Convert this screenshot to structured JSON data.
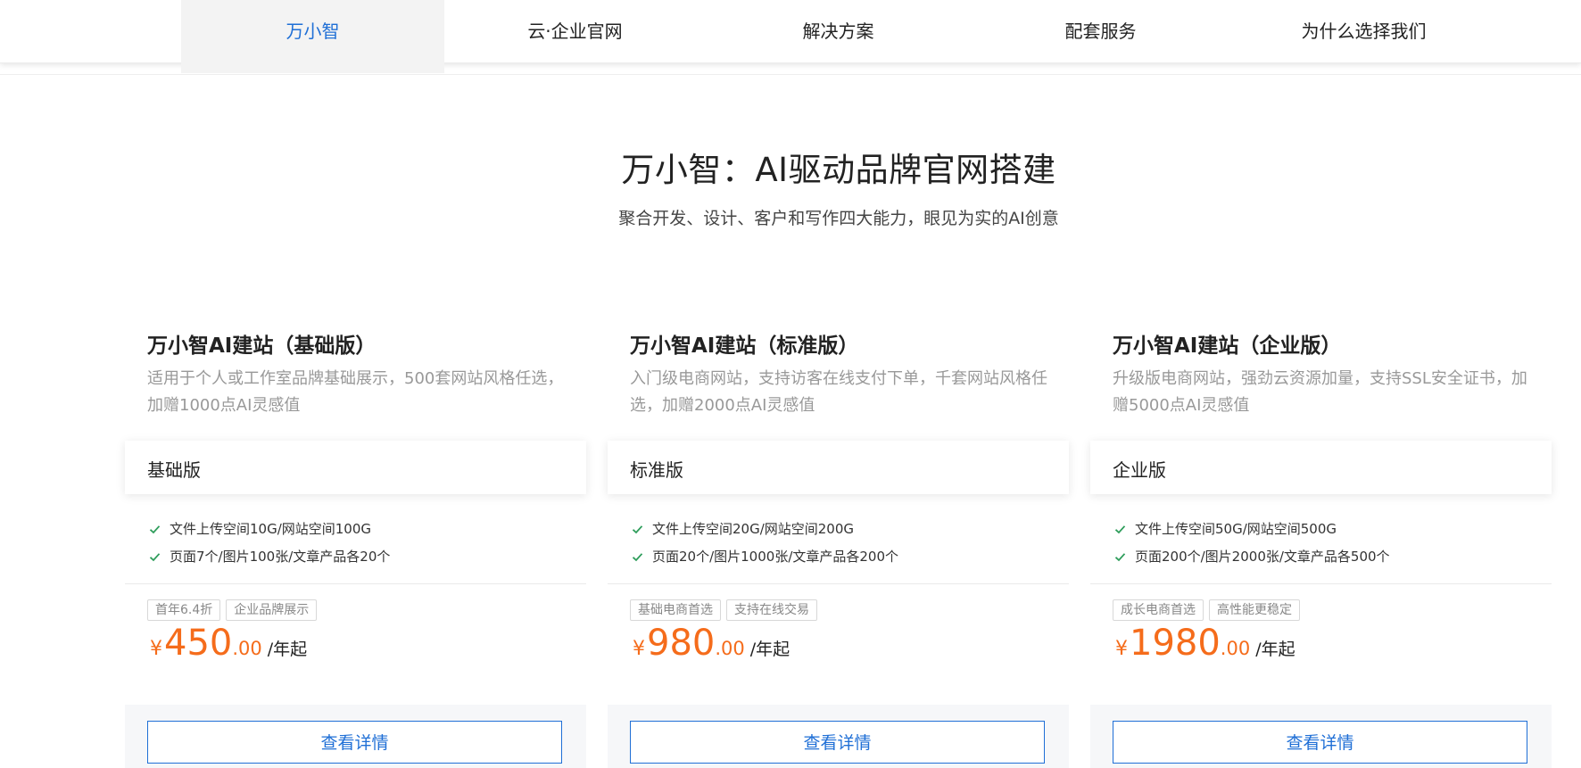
{
  "nav": {
    "tabs": [
      {
        "label": "万小智",
        "active": true
      },
      {
        "label": "云·企业官网",
        "active": false
      },
      {
        "label": "解决方案",
        "active": false
      },
      {
        "label": "配套服务",
        "active": false
      },
      {
        "label": "为什么选择我们",
        "active": false
      }
    ]
  },
  "hero": {
    "title": "万小智：AI驱动品牌官网搭建",
    "subtitle": "聚合开发、设计、客户和写作四大能力，眼见为实的AI创意"
  },
  "colors": {
    "accent_blue": "#1f6fd6",
    "price_orange": "#f56c1b",
    "check_green": "#2e9d5b"
  },
  "cards": [
    {
      "title": "万小智AI建站（基础版）",
      "desc": "适用于个人或工作室品牌基础展示，500套网站风格任选，加赠1000点AI灵感值",
      "edition": "基础版",
      "features": [
        "文件上传空间10G/网站空间100G",
        "页面7个/图片100张/文章产品各20个"
      ],
      "tags": [
        "首年6.4折",
        "企业品牌展示"
      ],
      "price_symbol": "¥",
      "price_int": "450",
      "price_dec": ".00",
      "price_unit": "/年起",
      "button": "查看详情",
      "check_icon": "check-icon"
    },
    {
      "title": "万小智AI建站（标准版）",
      "desc": "入门级电商网站，支持访客在线支付下单，千套网站风格任选，加赠2000点AI灵感值",
      "edition": "标准版",
      "features": [
        "文件上传空间20G/网站空间200G",
        "页面20个/图片1000张/文章产品各200个"
      ],
      "tags": [
        "基础电商首选",
        "支持在线交易"
      ],
      "price_symbol": "¥",
      "price_int": "980",
      "price_dec": ".00",
      "price_unit": "/年起",
      "button": "查看详情",
      "check_icon": "check-icon"
    },
    {
      "title": "万小智AI建站（企业版）",
      "desc": "升级版电商网站，强劲云资源加量，支持SSL安全证书，加赠5000点AI灵感值",
      "edition": "企业版",
      "features": [
        "文件上传空间50G/网站空间500G",
        "页面200个/图片2000张/文章产品各500个"
      ],
      "tags": [
        "成长电商首选",
        "高性能更稳定"
      ],
      "price_symbol": "¥",
      "price_int": "1980",
      "price_dec": ".00",
      "price_unit": "/年起",
      "button": "查看详情",
      "check_icon": "check-icon"
    }
  ]
}
